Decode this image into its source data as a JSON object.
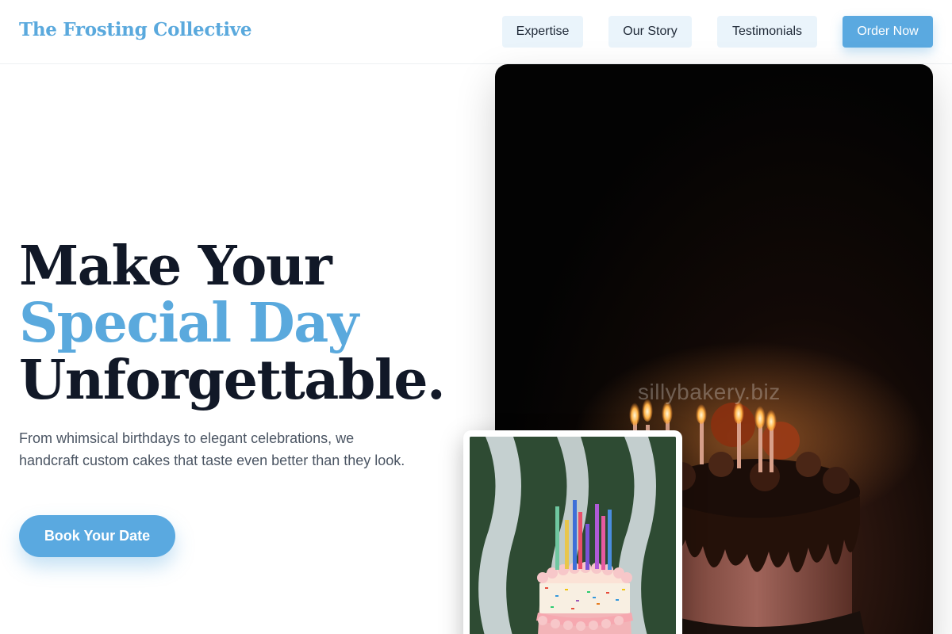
{
  "header": {
    "brand": "The Frosting Collective",
    "nav": {
      "expertise": "Expertise",
      "story": "Our Story",
      "testimonials": "Testimonials",
      "order": "Order Now"
    }
  },
  "hero": {
    "title_line1": "Make Your",
    "title_accent": "Special Day",
    "title_line3": "Unforgettable.",
    "description": "From whimsical birthdays to elegant celebrations, we handcraft custom cakes that taste even better than they look.",
    "cta_label": "Book Your Date"
  },
  "images": {
    "main_watermark": "sillybakery.biz",
    "main_photo": "chocolate-drip-cake-with-candles",
    "small_photo": "sprinkle-cake-with-colorful-candles"
  },
  "colors": {
    "accent": "#5aa9dd",
    "button": "#5aa9e0",
    "nav_bg": "#eaf4fb",
    "heading": "#111827",
    "body_text": "#4b5563"
  }
}
